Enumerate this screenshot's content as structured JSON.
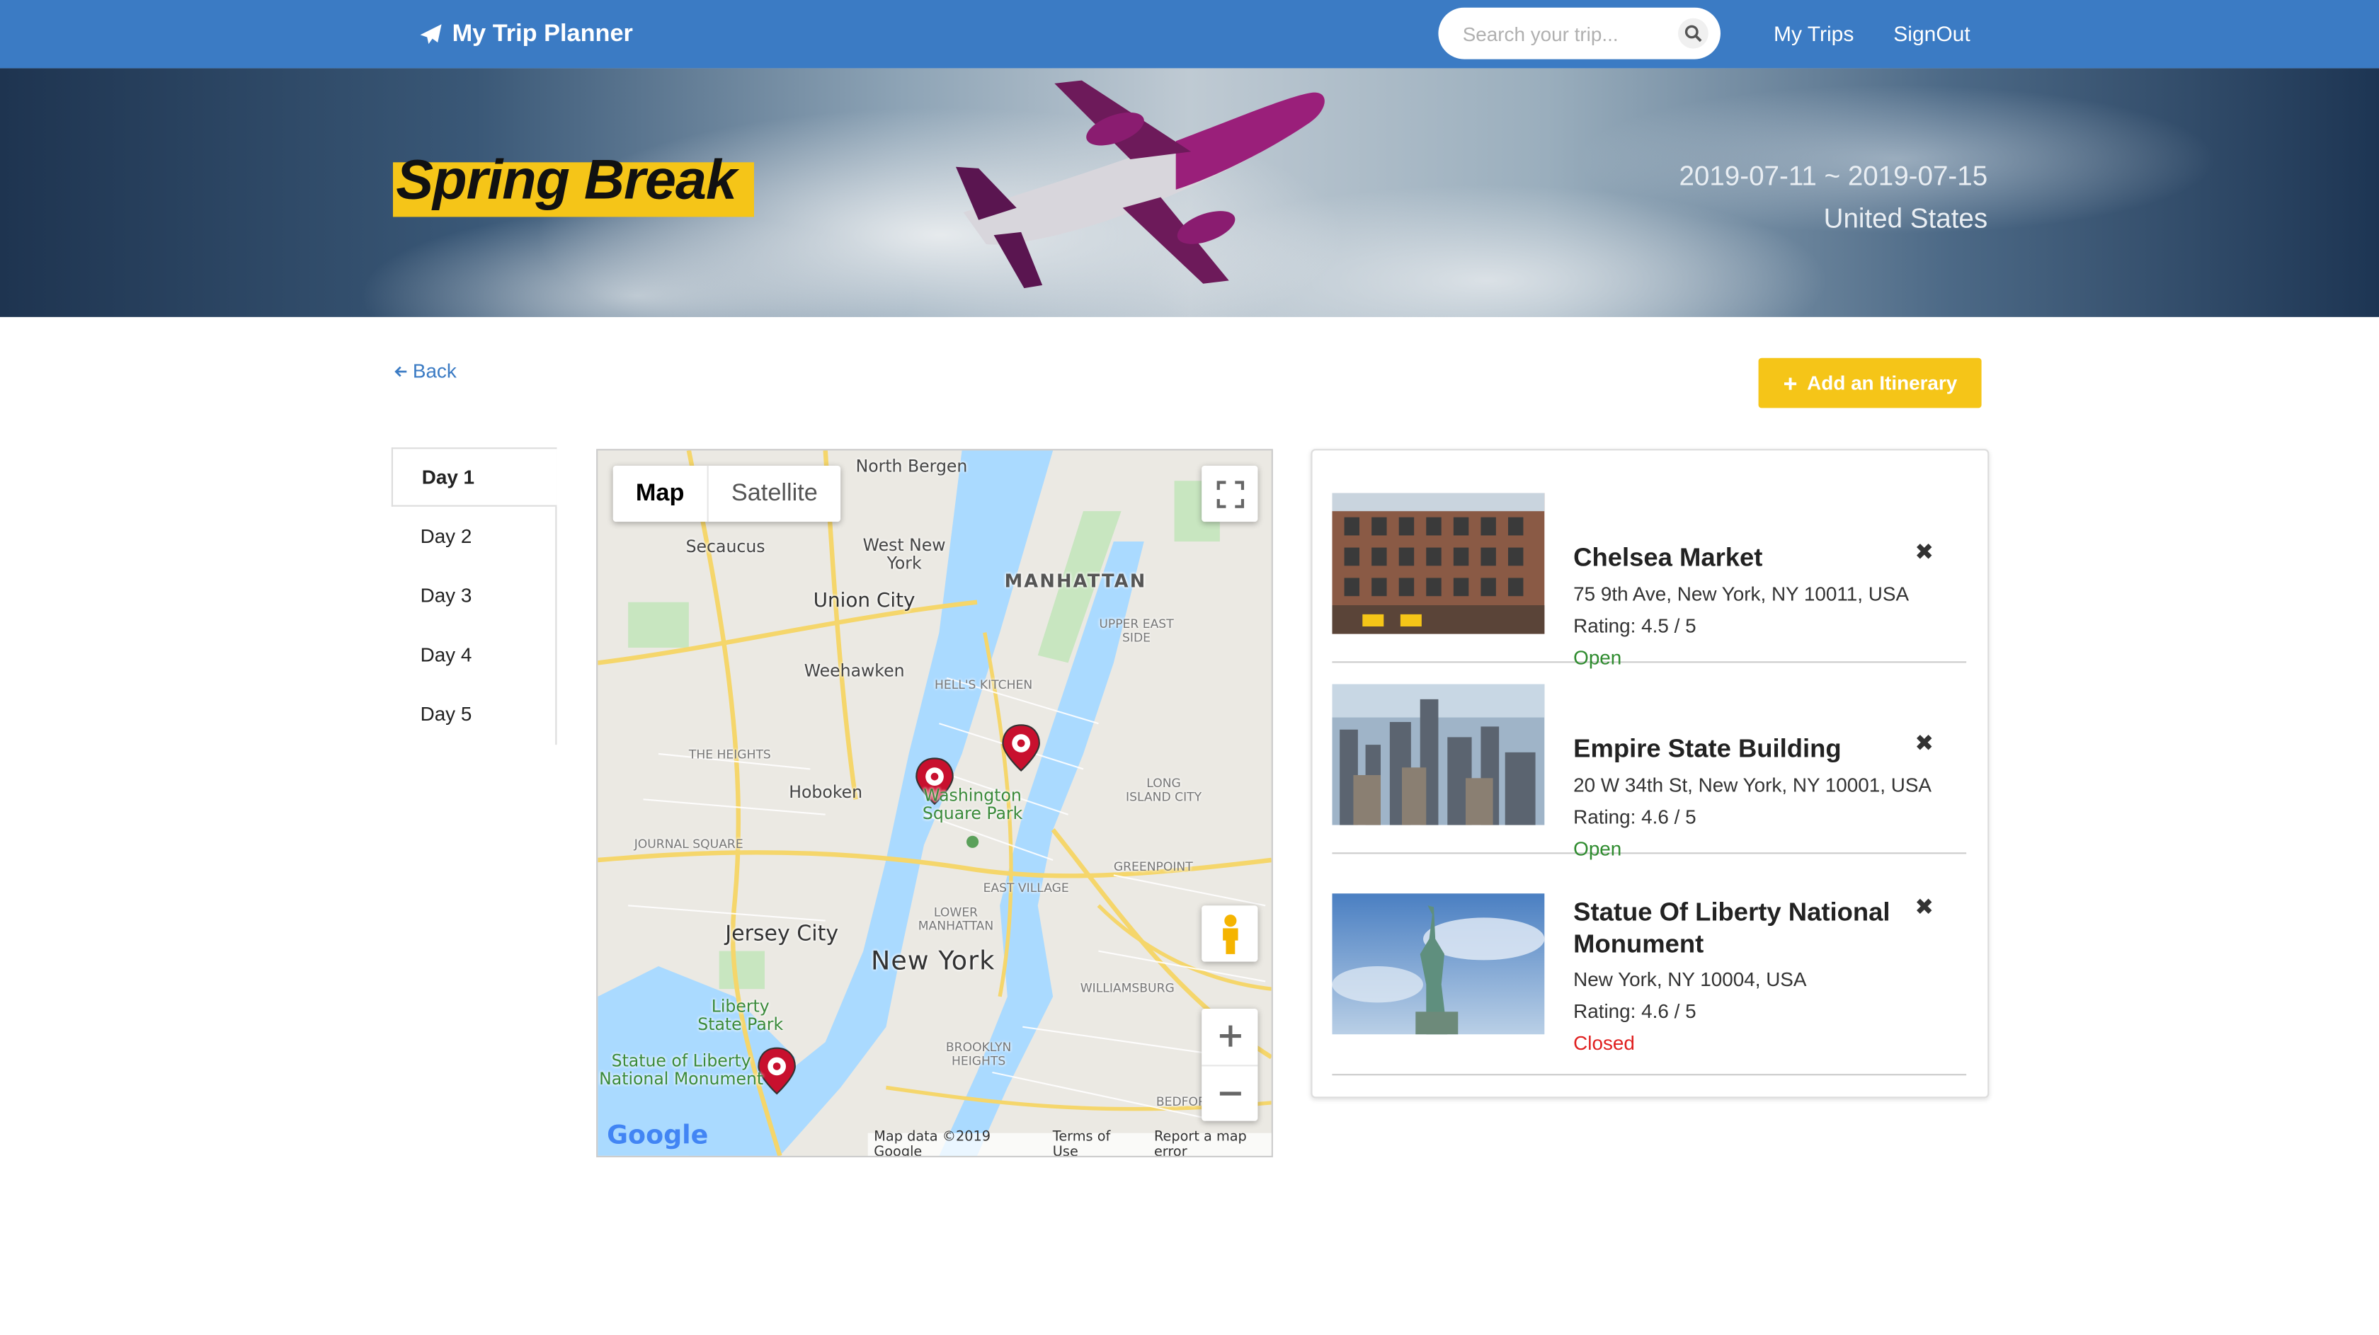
{
  "navbar": {
    "brand": "My Trip Planner",
    "search_placeholder": "Search your trip...",
    "links": [
      "My Trips",
      "SignOut"
    ]
  },
  "hero": {
    "title": "Spring Break",
    "dates": "2019-07-11 ~ 2019-07-15",
    "country": "United States"
  },
  "actions": {
    "back": "Back",
    "add_itinerary": "Add an Itinerary"
  },
  "days": [
    "Day 1",
    "Day 2",
    "Day 3",
    "Day 4",
    "Day 5"
  ],
  "map": {
    "type_map": "Map",
    "type_satellite": "Satellite",
    "footer": {
      "data": "Map data ©2019 Google",
      "terms": "Terms of Use",
      "report": "Report a map error"
    },
    "logo": "Google",
    "labels": {
      "north_bergen": "North Bergen",
      "secaucus": "Secaucus",
      "west_new_york": "West New York",
      "manhattan": "MANHATTAN",
      "union_city": "Union City",
      "upper_east_side": "UPPER EAST SIDE",
      "weehawken": "Weehawken",
      "hells_kitchen": "HELL'S KITCHEN",
      "the_heights": "THE HEIGHTS",
      "hoboken": "Hoboken",
      "washington_square": "Washington Square Park",
      "long_island_city": "LONG ISLAND CITY",
      "journal_square": "JOURNAL SQUARE",
      "east_village": "EAST VILLAGE",
      "greenpoint": "GREENPOINT",
      "lower_manhattan": "LOWER MANHATTAN",
      "jersey_city": "Jersey City",
      "new_york": "New York",
      "williamsburg": "WILLIAMSBURG",
      "liberty_state_park": "Liberty State Park",
      "statue_of_liberty": "Statue of Liberty National Monument",
      "brooklyn_heights": "BROOKLYN HEIGHTS",
      "bedford": "BEDFORD-S"
    }
  },
  "places": [
    {
      "name": "Chelsea Market",
      "address": "75 9th Ave, New York, NY 10011, USA",
      "rating": "Rating: 4.5 / 5",
      "status": "Open",
      "status_color": "#2e8b2e"
    },
    {
      "name": "Empire State Building",
      "address": "20 W 34th St, New York, NY 10001, USA",
      "rating": "Rating: 4.6 / 5",
      "status": "Open",
      "status_color": "#2e8b2e"
    },
    {
      "name": "Statue Of Liberty National Monument",
      "address": "New York, NY 10004, USA",
      "rating": "Rating: 4.6 / 5",
      "status": "Closed",
      "status_color": "#e02020"
    }
  ],
  "icons": {
    "brand": "paper-plane-icon",
    "search": "search-icon",
    "back": "arrow-left-icon",
    "add": "plus-icon",
    "remove": "close-icon",
    "fullscreen": "fullscreen-icon",
    "pegman": "pegman-icon",
    "zoom_in": "plus-icon",
    "zoom_out": "minus-icon",
    "marker": "map-marker-icon"
  },
  "colors": {
    "navbar": "#3b7bc4",
    "accent": "#f5c518",
    "open": "#2e8b2e",
    "closed": "#e02020"
  }
}
